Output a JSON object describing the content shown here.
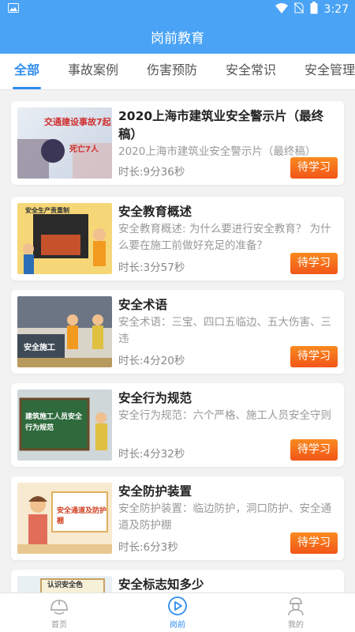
{
  "status": {
    "time": "3:27"
  },
  "header": {
    "title": "岗前教育"
  },
  "tabs": [
    "全部",
    "事故案例",
    "伤害预防",
    "安全常识",
    "安全管理"
  ],
  "items": [
    {
      "title": "2020上海市建筑业安全警示片（最终稿）",
      "desc": "2020上海市建筑业安全警示片（最终稿）",
      "duration": "时长:9分36秒",
      "status": "待学习",
      "thumb_text": [
        "交通建设事故7起",
        "死亡7人"
      ]
    },
    {
      "title": "安全教育概述",
      "desc": "安全教育概述: 为什么要进行安全教育？ 为什么要在施工前做好充足的准备？",
      "duration": "时长:3分57秒",
      "status": "待学习",
      "thumb_text": [
        "安全生产责重制"
      ]
    },
    {
      "title": "安全术语",
      "desc": "安全术语：三宝、四口五临边、五大伤害、三违",
      "duration": "时长:4分20秒",
      "status": "待学习",
      "thumb_text": [
        "安全施工"
      ]
    },
    {
      "title": "安全行为规范",
      "desc": "安全行为规范：六个严格、施工人员安全守则",
      "duration": "时长:4分32秒",
      "status": "待学习",
      "thumb_text": [
        "建筑施工人员安全行为规范"
      ]
    },
    {
      "title": "安全防护装置",
      "desc": "安全防护装置：临边防护，洞口防护、安全通道及防护棚",
      "duration": "时长:6分3秒",
      "status": "待学习",
      "thumb_text": [
        "安全通道及防护棚"
      ]
    },
    {
      "title": "安全标志知多少",
      "thumb_text": [
        "认识安全色"
      ]
    }
  ],
  "nav": {
    "home": "首页",
    "pre": "岗前",
    "mine": "我的"
  }
}
